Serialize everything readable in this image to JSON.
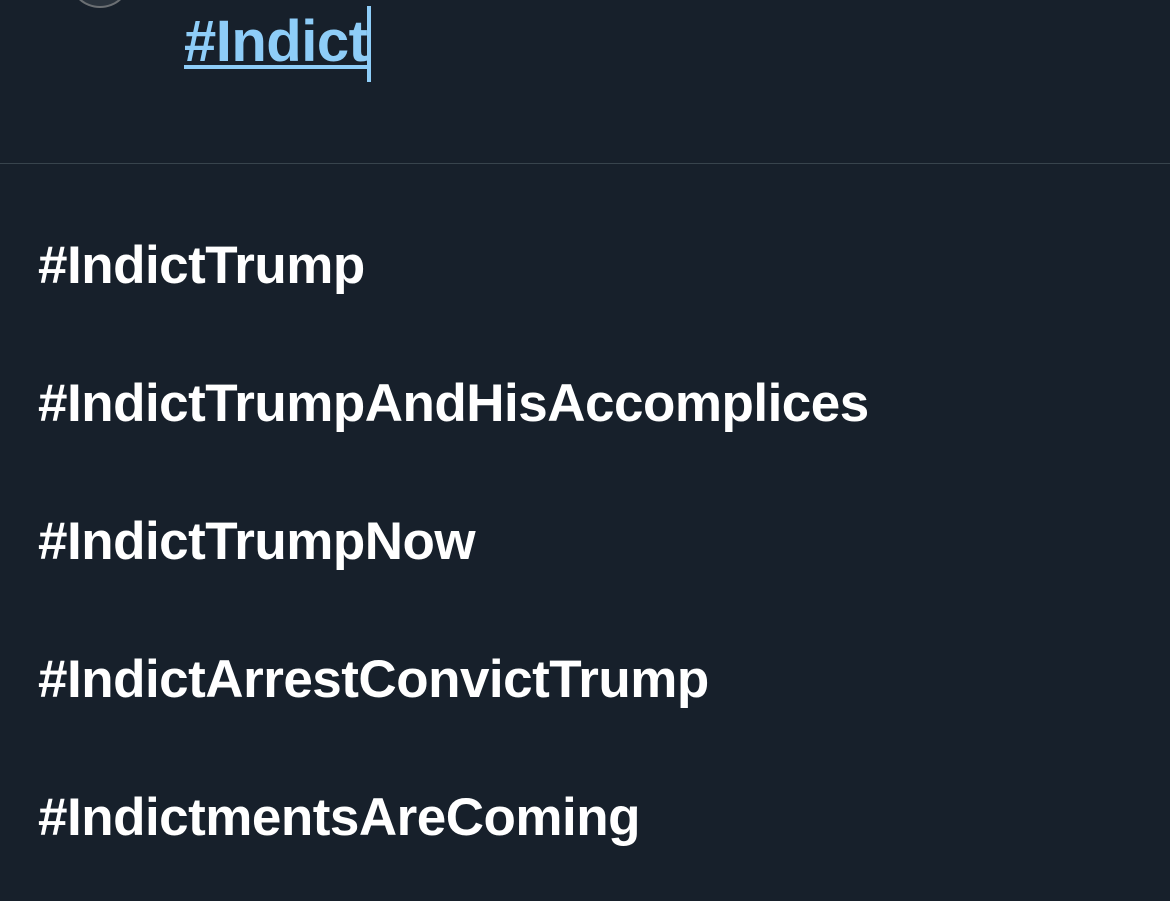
{
  "compose": {
    "text": "#Indict"
  },
  "suggestions": [
    "#IndictTrump",
    "#IndictTrumpAndHisAccomplices",
    "#IndictTrumpNow",
    "#IndictArrestConvictTrump",
    "#IndictmentsAreComing"
  ],
  "colors": {
    "background": "#17202b",
    "divider": "#38444d",
    "hashtag_link": "#8ecdf8",
    "suggestion_text": "#ffffff"
  }
}
